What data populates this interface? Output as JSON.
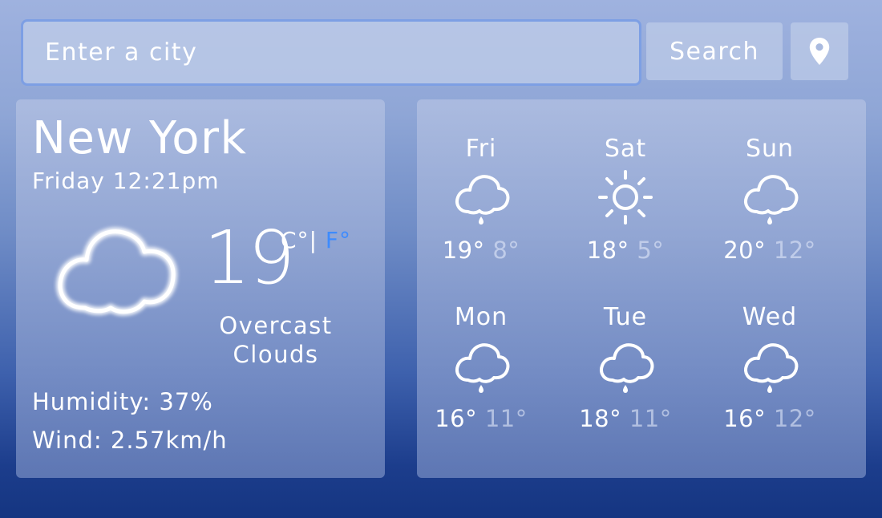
{
  "search": {
    "placeholder": "Enter a city",
    "button_label": "Search"
  },
  "current": {
    "city": "New York",
    "datetime": "Friday 12:21pm",
    "temperature": "19",
    "unit_c": "C°",
    "unit_separator": "|",
    "unit_f": "F°",
    "description_line1": "Overcast",
    "description_line2": "Clouds",
    "humidity": "Humidity: 37%",
    "wind": "Wind: 2.57km/h",
    "icon": "cloud-icon"
  },
  "forecast": [
    {
      "day": "Fri",
      "high": "19°",
      "low": "8°",
      "icon": "rain-cloud-icon"
    },
    {
      "day": "Sat",
      "high": "18°",
      "low": "5°",
      "icon": "sun-icon"
    },
    {
      "day": "Sun",
      "high": "20°",
      "low": "12°",
      "icon": "rain-cloud-icon"
    },
    {
      "day": "Mon",
      "high": "16°",
      "low": "11°",
      "icon": "rain-cloud-icon"
    },
    {
      "day": "Tue",
      "high": "18°",
      "low": "11°",
      "icon": "rain-cloud-icon"
    },
    {
      "day": "Wed",
      "high": "16°",
      "low": "12°",
      "icon": "rain-cloud-icon"
    }
  ],
  "colors": {
    "accent_unit": "#3d8bff",
    "input_border": "#7d9fe4",
    "background_top": "#9fb2df",
    "background_bottom": "#153581"
  }
}
